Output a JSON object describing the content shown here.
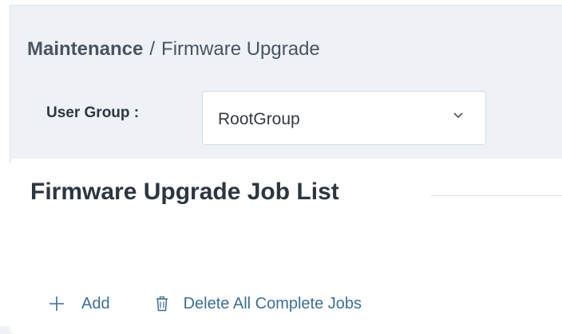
{
  "breadcrumb": {
    "root": "Maintenance",
    "separator": "/",
    "current": "Firmware Upgrade"
  },
  "user_group": {
    "label": "User Group :",
    "selected": "RootGroup",
    "dropdown_icon": "chevron-down-icon"
  },
  "panel": {
    "title": "Firmware Upgrade Job List"
  },
  "actions": {
    "add": {
      "label": "Add",
      "icon": "plus-icon"
    },
    "delete_all": {
      "label": "Delete All Complete Jobs",
      "icon": "trash-icon"
    }
  },
  "colors": {
    "background": "#eef2f6",
    "panel": "#ffffff",
    "action": "#3c6e96",
    "text": "#2d3640"
  }
}
